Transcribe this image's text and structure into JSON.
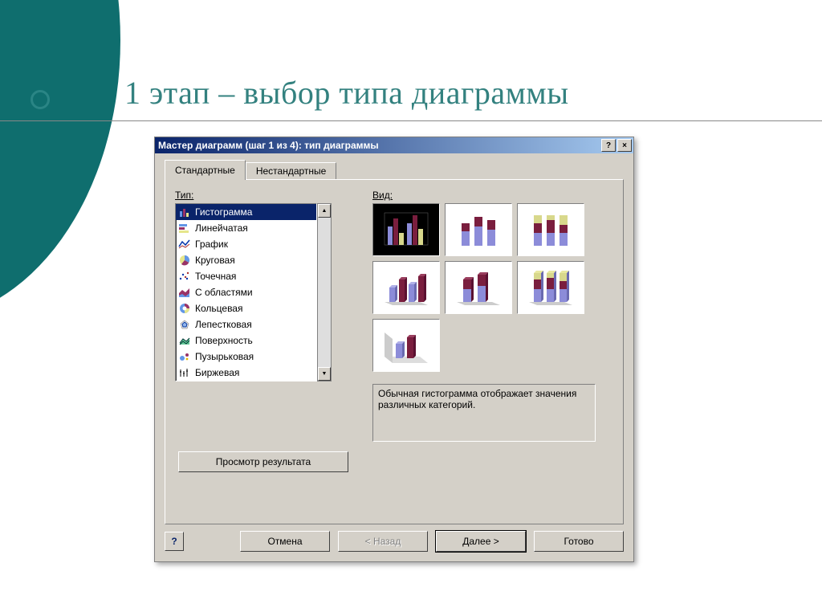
{
  "slide": {
    "title": "1 этап – выбор типа диаграммы"
  },
  "dialog": {
    "title": "Мастер диаграмм (шаг 1 из 4): тип диаграммы",
    "help_btn": "?",
    "close_btn": "×",
    "tabs": {
      "standard": "Стандартные",
      "custom": "Нестандартные"
    },
    "type_label": "Тип:",
    "view_label": "Вид:",
    "types": {
      "items": [
        {
          "label": "Гистограмма",
          "id": "column"
        },
        {
          "label": "Линейчатая",
          "id": "bar"
        },
        {
          "label": "График",
          "id": "line"
        },
        {
          "label": "Круговая",
          "id": "pie"
        },
        {
          "label": "Точечная",
          "id": "scatter"
        },
        {
          "label": "С областями",
          "id": "area"
        },
        {
          "label": "Кольцевая",
          "id": "doughnut"
        },
        {
          "label": "Лепестковая",
          "id": "radar"
        },
        {
          "label": "Поверхность",
          "id": "surface"
        },
        {
          "label": "Пузырьковая",
          "id": "bubble"
        },
        {
          "label": "Биржевая",
          "id": "stock"
        }
      ],
      "selected_index": 0
    },
    "description": "Обычная гистограмма отображает значения различных категорий.",
    "preview_btn": "Просмотр результата",
    "buttons": {
      "footer_help": "?",
      "cancel": "Отмена",
      "back": "< Назад",
      "next": "Далее >",
      "finish": "Готово"
    }
  }
}
